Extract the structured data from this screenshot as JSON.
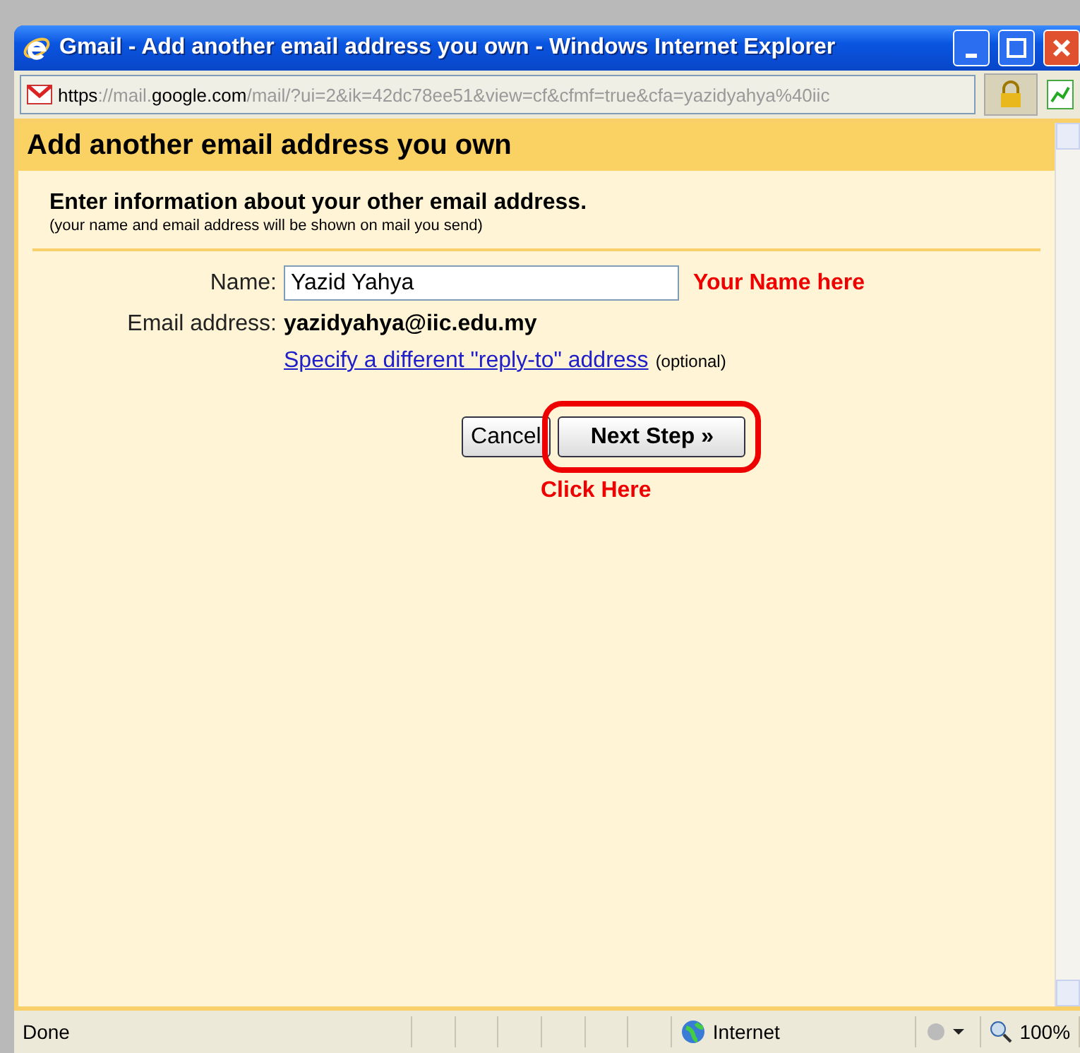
{
  "window": {
    "title": "Gmail - Add another email address you own - Windows Internet Explorer"
  },
  "address_bar": {
    "url_parts": [
      {
        "text": "https",
        "emphasis": true
      },
      {
        "text": "://mail.",
        "emphasis": false
      },
      {
        "text": "google.com",
        "emphasis": true
      },
      {
        "text": "/mail/?ui=2&ik=42dc78ee51&view=cf&cfmf=true&cfa=yazidyahya%40iic",
        "emphasis": false
      }
    ]
  },
  "page": {
    "heading": "Add another email address you own",
    "intro": "Enter information about your other email address.",
    "note": "(your name and email address will be shown on mail you send)",
    "name_label": "Name:",
    "name_value": "Yazid Yahya",
    "name_hint": "Your Name here",
    "email_label": "Email address:",
    "email_value": "yazidyahya@iic.edu.my",
    "reply_link": "Specify a different \"reply-to\" address",
    "optional": "(optional)",
    "buttons": [
      {
        "label": "Cancel",
        "highlighted": false
      },
      {
        "label": "Next Step »",
        "highlighted": true
      }
    ],
    "callout": "Click Here"
  },
  "status_bar": {
    "text": "Done",
    "zone": "Internet",
    "zoom": "100%"
  }
}
